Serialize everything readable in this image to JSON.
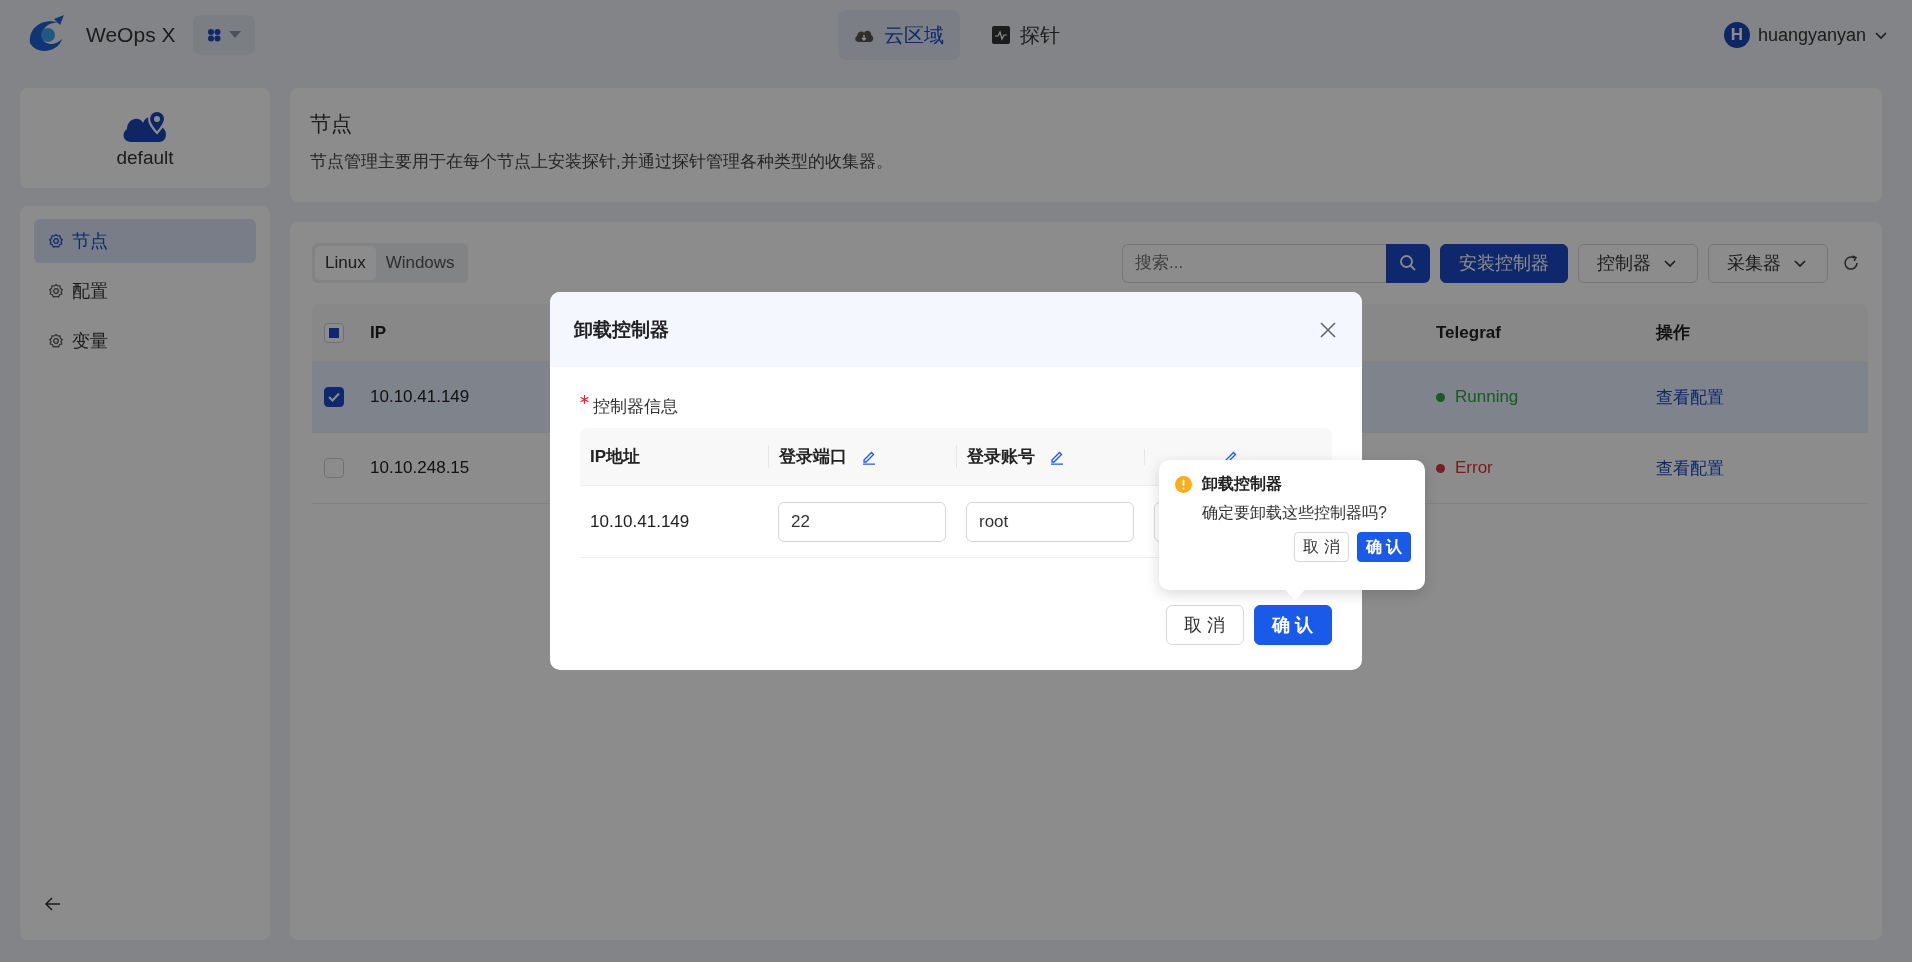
{
  "app": {
    "name": "WeOps X"
  },
  "top_nav": [
    {
      "label": "云区域",
      "selected": true,
      "kind": "cloud"
    },
    {
      "label": "探针",
      "selected": false,
      "kind": "probe"
    }
  ],
  "user": {
    "avatar_letter": "H",
    "name": "huangyanyan"
  },
  "sidebar": {
    "area": {
      "name": "default"
    },
    "items": [
      {
        "label": "节点",
        "selected": true
      },
      {
        "label": "配置",
        "selected": false
      },
      {
        "label": "变量",
        "selected": false
      }
    ]
  },
  "header": {
    "title": "节点",
    "description": "节点管理主要用于在每个节点上安装探针,并通过探针管理各种类型的收集器。"
  },
  "toolbar": {
    "os_tabs": [
      {
        "label": "Linux",
        "selected": true
      },
      {
        "label": "Windows",
        "selected": false
      }
    ],
    "search": {
      "placeholder": "搜索..."
    },
    "buttons": [
      {
        "label": "安装控制器",
        "kind": "primary"
      },
      {
        "label": "控制器",
        "kind": "dropdown"
      },
      {
        "label": "采集器",
        "kind": "dropdown"
      }
    ]
  },
  "table": {
    "select_all": {
      "indeterminate": true
    },
    "columns": [
      "IP",
      "Telegraf",
      "操作"
    ],
    "rows": [
      {
        "checked": true,
        "ip": "10.10.41.149",
        "telegraf": "Running",
        "color": "#1a5a24",
        "action": "查看配置"
      },
      {
        "checked": false,
        "ip": "10.10.248.15",
        "telegraf": "Error",
        "color": "#781e22",
        "action": "查看配置"
      }
    ]
  },
  "dialog": {
    "title": "卸载控制器",
    "field_label": "控制器信息",
    "required": true,
    "columns": [
      {
        "label": "IP地址",
        "editable": false
      },
      {
        "label": "登录端口",
        "editable": true
      },
      {
        "label": "登录账号",
        "editable": true
      },
      {
        "editable": true
      }
    ],
    "rows": [
      {
        "ip": "10.10.41.149",
        "port": "22",
        "account": "root"
      }
    ],
    "buttons": [
      {
        "label": "取 消",
        "kind": "default"
      },
      {
        "label": "确 认",
        "kind": "primary"
      }
    ]
  },
  "popconfirm": {
    "title": "卸载控制器",
    "message": "确定要卸载这些控制器吗?",
    "buttons": [
      {
        "label": "取 消",
        "kind": "default"
      },
      {
        "label": "确 认",
        "kind": "primary"
      }
    ]
  }
}
